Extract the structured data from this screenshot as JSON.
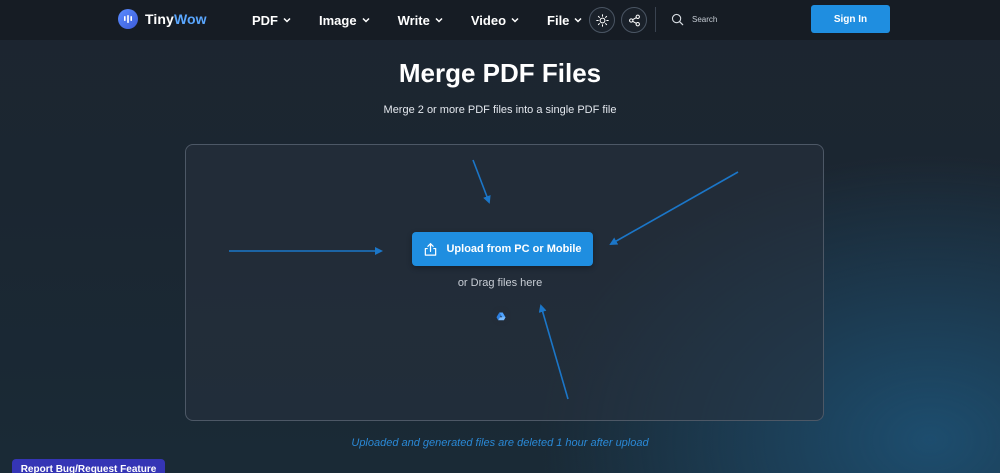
{
  "header": {
    "logo": {
      "name_part1": "Tiny",
      "name_part2": "Wow"
    },
    "nav": [
      {
        "label": "PDF"
      },
      {
        "label": "Image"
      },
      {
        "label": "Write"
      },
      {
        "label": "Video"
      },
      {
        "label": "File"
      }
    ],
    "icons": {
      "theme": "sun-icon",
      "share": "share-icon",
      "search": "search-icon"
    },
    "search": {
      "placeholder": "Search"
    },
    "signin_label": "Sign In"
  },
  "main": {
    "title": "Merge PDF Files",
    "subtitle": "Merge 2 or more PDF files into a single PDF file",
    "upload_label": "Upload from PC or Mobile",
    "drag_text": "or Drag files here",
    "cloud_icon": "google-drive-icon",
    "note": "Uploaded and generated files are deleted 1 hour after upload"
  },
  "footer": {
    "report_label": "Report Bug/Request Feature"
  },
  "colors": {
    "accent": "#1f8ee0",
    "arrow": "#1b76c8",
    "report": "#3535b5",
    "background": "#1b2631"
  }
}
